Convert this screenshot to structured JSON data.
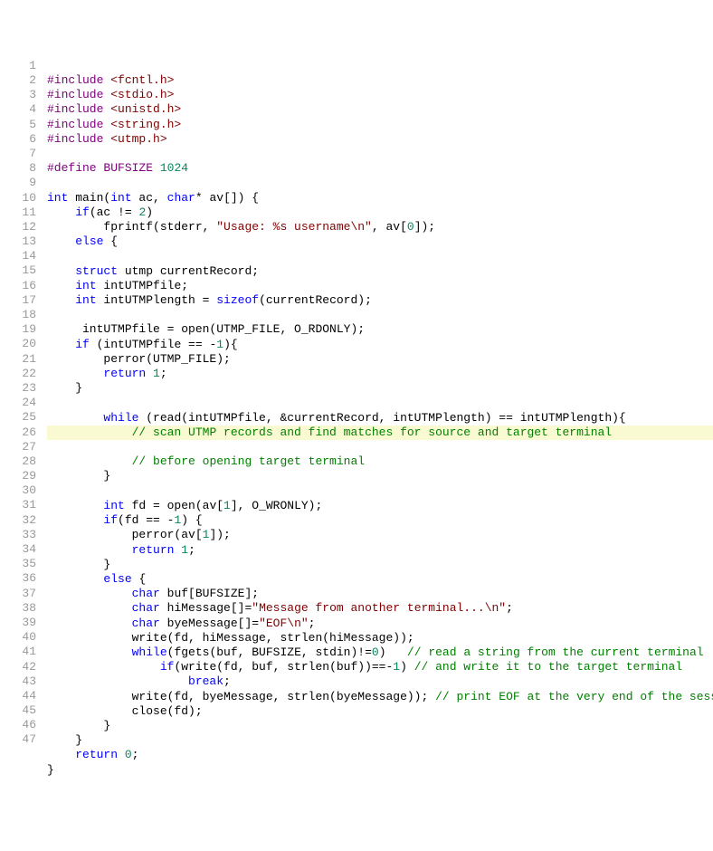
{
  "line_count": 47,
  "lines": {
    "l1": {
      "pp": "#include ",
      "inc": "<fcntl.h>"
    },
    "l2": {
      "pp": "#include ",
      "inc": "<stdio.h>"
    },
    "l3": {
      "pp": "#include ",
      "inc": "<unistd.h>"
    },
    "l4": {
      "pp": "#include ",
      "inc": "<string.h>"
    },
    "l5": {
      "pp": "#include ",
      "inc": "<utmp.h>"
    },
    "l7": {
      "pp": "#define ",
      "name": "BUFSIZE ",
      "val": "1024"
    },
    "l9": {
      "a": "int",
      "b": " main(",
      "c": "int",
      "d": " ac, ",
      "e": "char",
      "f": "* av[]) {"
    },
    "l10": {
      "a": "    ",
      "b": "if",
      "c": "(ac != ",
      "d": "2",
      "e": ")"
    },
    "l11": {
      "a": "        fprintf(stderr, ",
      "b": "\"Usage: %s username\\n\"",
      "c": ", av[",
      "d": "0",
      "e": "]);"
    },
    "l12": {
      "a": "    ",
      "b": "else",
      "c": " {"
    },
    "l14": {
      "a": "    ",
      "b": "struct",
      "c": " utmp currentRecord;"
    },
    "l15": {
      "a": "    ",
      "b": "int",
      "c": " intUTMPfile;"
    },
    "l16": {
      "a": "    ",
      "b": "int",
      "c": " intUTMPlength = ",
      "d": "sizeof",
      "e": "(currentRecord);"
    },
    "l18": {
      "a": "     intUTMPfile = open(UTMP_FILE, O_RDONLY);"
    },
    "l19": {
      "a": "    ",
      "b": "if",
      "c": " (intUTMPfile == -",
      "d": "1",
      "e": "){"
    },
    "l20": {
      "a": "        perror(UTMP_FILE);"
    },
    "l21": {
      "a": "        ",
      "b": "return",
      "c": " ",
      "d": "1",
      "e": ";"
    },
    "l22": {
      "a": "    }"
    },
    "l24": {
      "a": "        ",
      "b": "while",
      "c": " (read(intUTMPfile, &currentRecord, intUTMPlength) == intUTMPlength){"
    },
    "l25": {
      "a": "            ",
      "b": "// scan UTMP records and find matches for source and target terminal"
    },
    "l26": {
      "a": "            ",
      "b": "// before opening target terminal"
    },
    "l27": {
      "a": "        }"
    },
    "l29": {
      "a": "        ",
      "b": "int",
      "c": " fd = open(av[",
      "d": "1",
      "e": "], O_WRONLY);"
    },
    "l30": {
      "a": "        ",
      "b": "if",
      "c": "(fd == -",
      "d": "1",
      "e": ") {"
    },
    "l31": {
      "a": "            perror(av[",
      "b": "1",
      "c": "]);"
    },
    "l32": {
      "a": "            ",
      "b": "return",
      "c": " ",
      "d": "1",
      "e": ";"
    },
    "l33": {
      "a": "        }"
    },
    "l34": {
      "a": "        ",
      "b": "else",
      "c": " {"
    },
    "l35": {
      "a": "            ",
      "b": "char",
      "c": " buf[BUFSIZE];"
    },
    "l36": {
      "a": "            ",
      "b": "char",
      "c": " hiMessage[]=",
      "d": "\"Message from another terminal...\\n\"",
      "e": ";"
    },
    "l37": {
      "a": "            ",
      "b": "char",
      "c": " byeMessage[]=",
      "d": "\"EOF\\n\"",
      "e": ";"
    },
    "l38": {
      "a": "            write(fd, hiMessage, strlen(hiMessage));"
    },
    "l39": {
      "a": "            ",
      "b": "while",
      "c": "(fgets(buf, BUFSIZE, stdin)!=",
      "d": "0",
      "e": ")   ",
      "f": "// read a string from the current terminal"
    },
    "l40": {
      "a": "                ",
      "b": "if",
      "c": "(write(fd, buf, strlen(buf))==-",
      "d": "1",
      "e": ") ",
      "f": "// and write it to the target terminal"
    },
    "l41": {
      "a": "                    ",
      "b": "break",
      "c": ";"
    },
    "l42": {
      "a": "            write(fd, byeMessage, strlen(byeMessage)); ",
      "b": "// print EOF at the very end of the session"
    },
    "l43": {
      "a": "            close(fd);"
    },
    "l44": {
      "a": "        }"
    },
    "l45": {
      "a": "    }"
    },
    "l46": {
      "a": "    ",
      "b": "return",
      "c": " ",
      "d": "0",
      "e": ";"
    },
    "l47": {
      "a": "}"
    }
  }
}
